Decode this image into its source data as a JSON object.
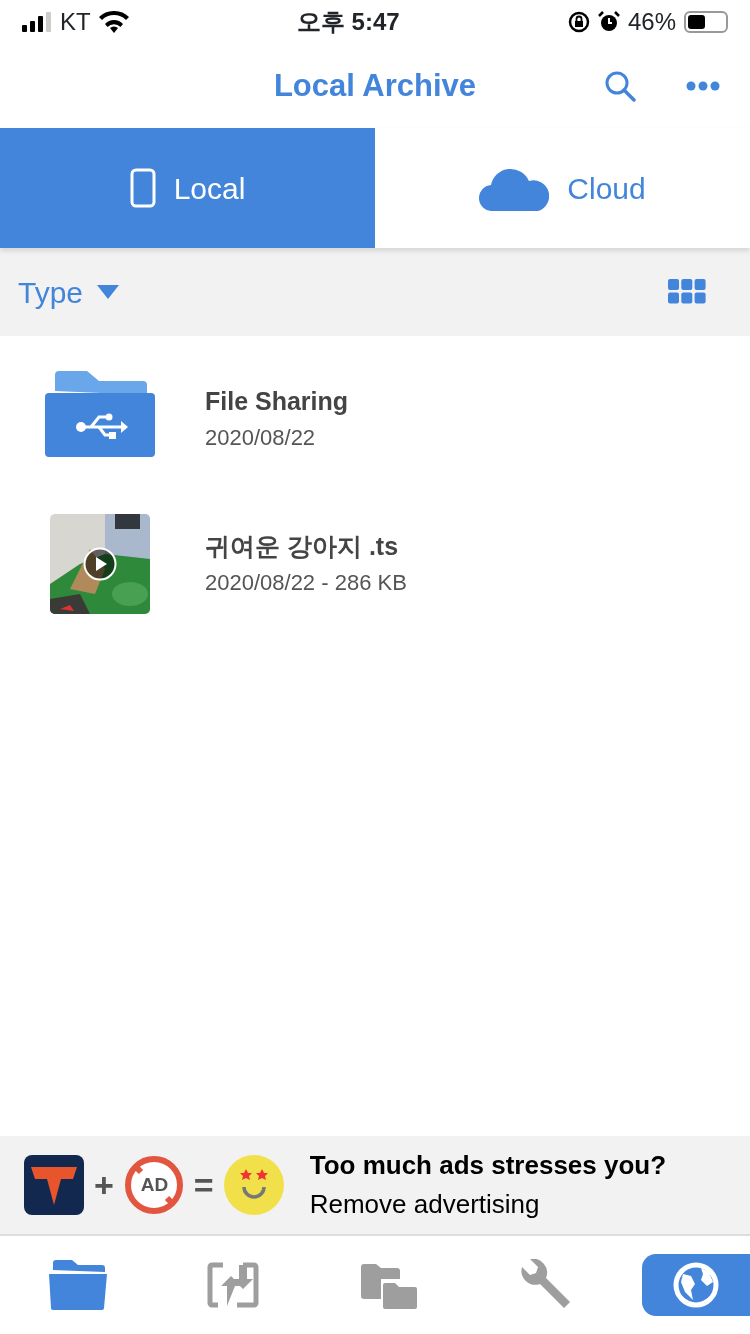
{
  "status_bar": {
    "carrier": "KT",
    "time": "오후 5:47",
    "battery": "46%"
  },
  "header": {
    "title": "Local Archive"
  },
  "segments": [
    {
      "label": "Local",
      "kind": "phone",
      "selected": true
    },
    {
      "label": "Cloud",
      "kind": "cloud",
      "selected": false
    }
  ],
  "filter": {
    "label": "Type"
  },
  "files": [
    {
      "kind": "usb-folder",
      "name": "File Sharing",
      "detail": "2020/08/22"
    },
    {
      "kind": "video",
      "name": "귀여운 강아지 .ts",
      "detail": "2020/08/22 - 286 KB"
    }
  ],
  "ad_banner": {
    "no_ad_mark": "AD",
    "plus": "+",
    "equals": "=",
    "headline": "Too much ads stresses you?",
    "link": "Remove advertising"
  },
  "tab_bar": [
    {
      "kind": "folder",
      "selected": true
    },
    {
      "kind": "transfer",
      "selected": false
    },
    {
      "kind": "folders",
      "selected": false
    },
    {
      "kind": "wrench",
      "selected": false
    },
    {
      "kind": "globe",
      "selected": true
    }
  ]
}
